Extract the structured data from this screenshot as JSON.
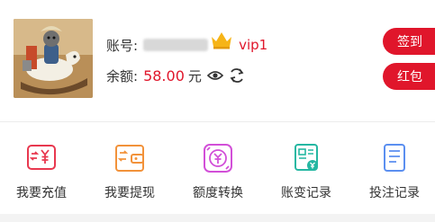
{
  "user": {
    "account_label": "账号:",
    "vip_label": "vip1",
    "balance_label": "余额:",
    "balance_value": "58.00",
    "balance_unit": "元"
  },
  "actions": {
    "sign_in": "签到",
    "red_packet": "红包"
  },
  "menu": [
    {
      "label": "我要充值",
      "icon": "recharge-icon"
    },
    {
      "label": "我要提现",
      "icon": "withdraw-icon"
    },
    {
      "label": "额度转换",
      "icon": "transfer-icon"
    },
    {
      "label": "账变记录",
      "icon": "account-record-icon"
    },
    {
      "label": "投注记录",
      "icon": "bet-record-icon"
    }
  ],
  "colors": {
    "accent_red": "#e0162b",
    "recharge": "#e8384f",
    "withdraw": "#f2923a",
    "transfer": "#d24fd8",
    "account_record": "#25b7a2",
    "bet_record": "#5b8ff0",
    "crown": "#f6b417"
  }
}
